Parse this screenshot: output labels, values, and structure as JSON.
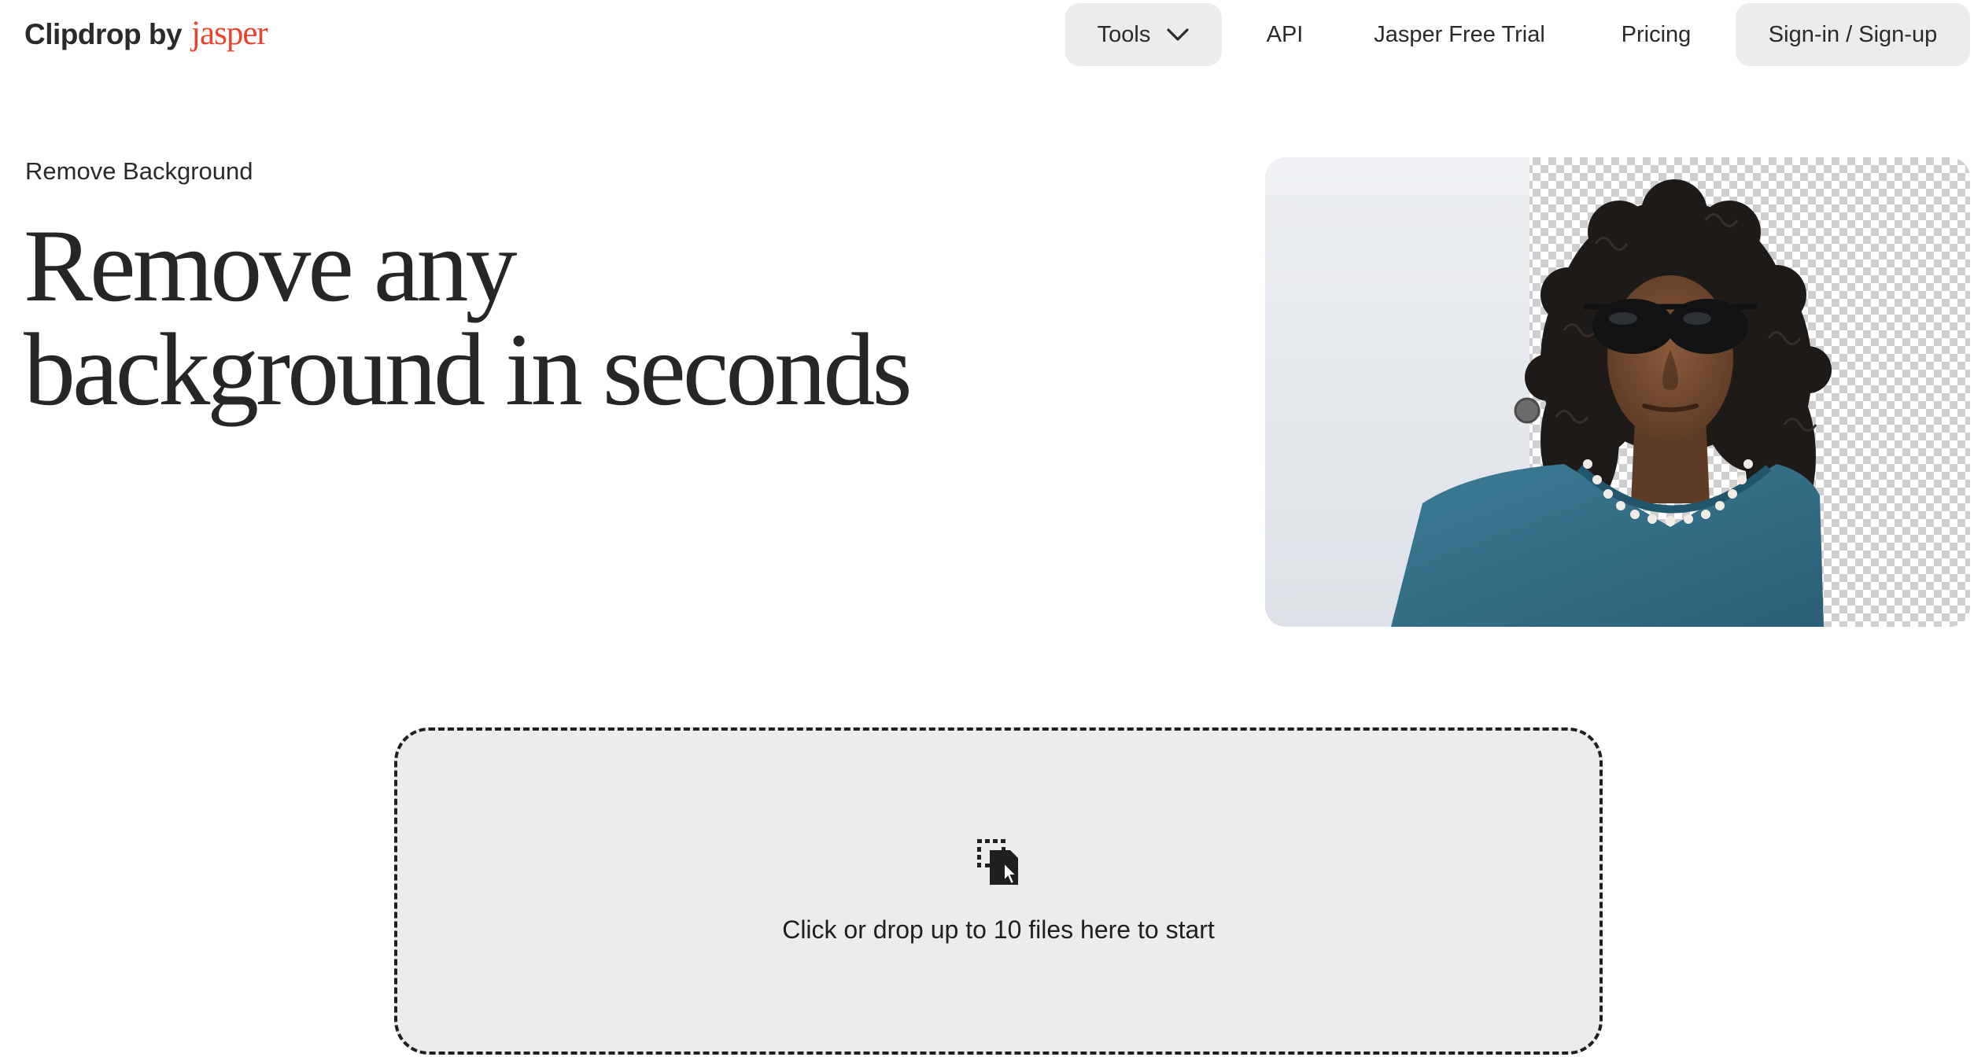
{
  "header": {
    "logo_text": "Clipdrop by",
    "logo_brand": "jasper",
    "nav": {
      "tools_label": "Tools",
      "api_label": "API",
      "trial_label": "Jasper Free Trial",
      "pricing_label": "Pricing",
      "signin_label": "Sign-in / Sign-up"
    }
  },
  "hero": {
    "eyebrow": "Remove Background",
    "title_line1": "Remove any",
    "title_line2": "background in seconds"
  },
  "upload": {
    "prompt": "Click or drop up to 10 files here to start"
  },
  "colors": {
    "brand_accent": "#e8462c",
    "pill_background": "#ececec",
    "dropzone_background": "#ececec",
    "text": "#1f1f1f"
  }
}
